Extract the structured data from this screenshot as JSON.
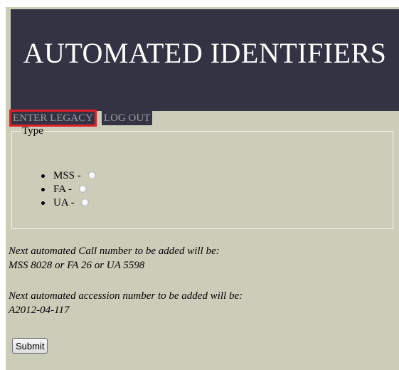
{
  "header": {
    "title": "AUTOMATED IDENTIFIERS"
  },
  "nav": {
    "items": [
      {
        "label": "ENTER LEGACY",
        "active": true
      },
      {
        "label": "LOG OUT",
        "active": false
      }
    ]
  },
  "type_group": {
    "legend": "Type",
    "options": [
      {
        "label": "MSS -",
        "selected": false
      },
      {
        "label": "FA -",
        "selected": false
      },
      {
        "label": "UA -",
        "selected": false
      }
    ]
  },
  "info": {
    "call_number_heading": "Next automated Call number to be added will be:",
    "call_number_value": "MSS 8028 or FA 26 or UA 5598",
    "accession_heading": "Next automated accession number to be added will be:",
    "accession_value": "A2012-04-117"
  },
  "form": {
    "submit_label": "Submit"
  },
  "colors": {
    "banner": "#333344",
    "background": "#cccdb9",
    "nav_text": "#9d9d9d",
    "highlight": "#e01f26"
  }
}
